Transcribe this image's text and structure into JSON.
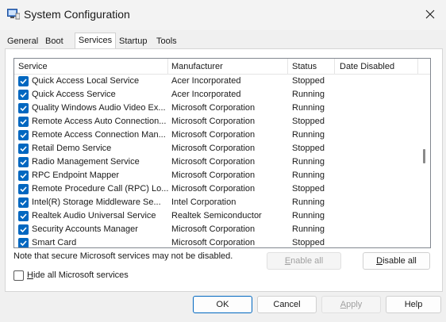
{
  "window": {
    "title": "System Configuration"
  },
  "tabs": [
    {
      "label": "General"
    },
    {
      "label": "Boot"
    },
    {
      "label": "Services"
    },
    {
      "label": "Startup"
    },
    {
      "label": "Tools"
    }
  ],
  "table": {
    "headers": {
      "service": "Service",
      "manufacturer": "Manufacturer",
      "status": "Status",
      "date_disabled": "Date Disabled"
    },
    "rows": [
      {
        "service": "Quick Access Local Service",
        "manufacturer": "Acer Incorporated",
        "status": "Stopped",
        "date_disabled": "",
        "checked": true
      },
      {
        "service": "Quick Access Service",
        "manufacturer": "Acer Incorporated",
        "status": "Running",
        "date_disabled": "",
        "checked": true
      },
      {
        "service": "Quality Windows Audio Video Ex...",
        "manufacturer": "Microsoft Corporation",
        "status": "Running",
        "date_disabled": "",
        "checked": true
      },
      {
        "service": "Remote Access Auto Connection...",
        "manufacturer": "Microsoft Corporation",
        "status": "Stopped",
        "date_disabled": "",
        "checked": true
      },
      {
        "service": "Remote Access Connection Man...",
        "manufacturer": "Microsoft Corporation",
        "status": "Running",
        "date_disabled": "",
        "checked": true
      },
      {
        "service": "Retail Demo Service",
        "manufacturer": "Microsoft Corporation",
        "status": "Stopped",
        "date_disabled": "",
        "checked": true
      },
      {
        "service": "Radio Management Service",
        "manufacturer": "Microsoft Corporation",
        "status": "Running",
        "date_disabled": "",
        "checked": true
      },
      {
        "service": "RPC Endpoint Mapper",
        "manufacturer": "Microsoft Corporation",
        "status": "Running",
        "date_disabled": "",
        "checked": true
      },
      {
        "service": "Remote Procedure Call (RPC) Lo...",
        "manufacturer": "Microsoft Corporation",
        "status": "Stopped",
        "date_disabled": "",
        "checked": true
      },
      {
        "service": "Intel(R) Storage Middleware Se...",
        "manufacturer": "Intel Corporation",
        "status": "Running",
        "date_disabled": "",
        "checked": true
      },
      {
        "service": "Realtek Audio Universal Service",
        "manufacturer": "Realtek Semiconductor",
        "status": "Running",
        "date_disabled": "",
        "checked": true
      },
      {
        "service": "Security Accounts Manager",
        "manufacturer": "Microsoft Corporation",
        "status": "Running",
        "date_disabled": "",
        "checked": true
      },
      {
        "service": "Smart Card",
        "manufacturer": "Microsoft Corporation",
        "status": "Stopped",
        "date_disabled": "",
        "checked": true
      }
    ]
  },
  "note": "Note that secure Microsoft services may not be disabled.",
  "enable_all": {
    "mnemonic": "E",
    "rest": "nable all"
  },
  "disable_all": {
    "mnemonic": "D",
    "rest": "isable all"
  },
  "hide_ms": {
    "mnemonic": "H",
    "rest": "ide all Microsoft services",
    "checked": false
  },
  "footer": {
    "ok": "OK",
    "cancel": "Cancel",
    "apply": {
      "mnemonic": "A",
      "rest": "pply"
    },
    "help": "Help"
  },
  "colors": {
    "accent": "#0067c0",
    "panel": "#ffffff",
    "window_bg": "#f0f0f0"
  }
}
